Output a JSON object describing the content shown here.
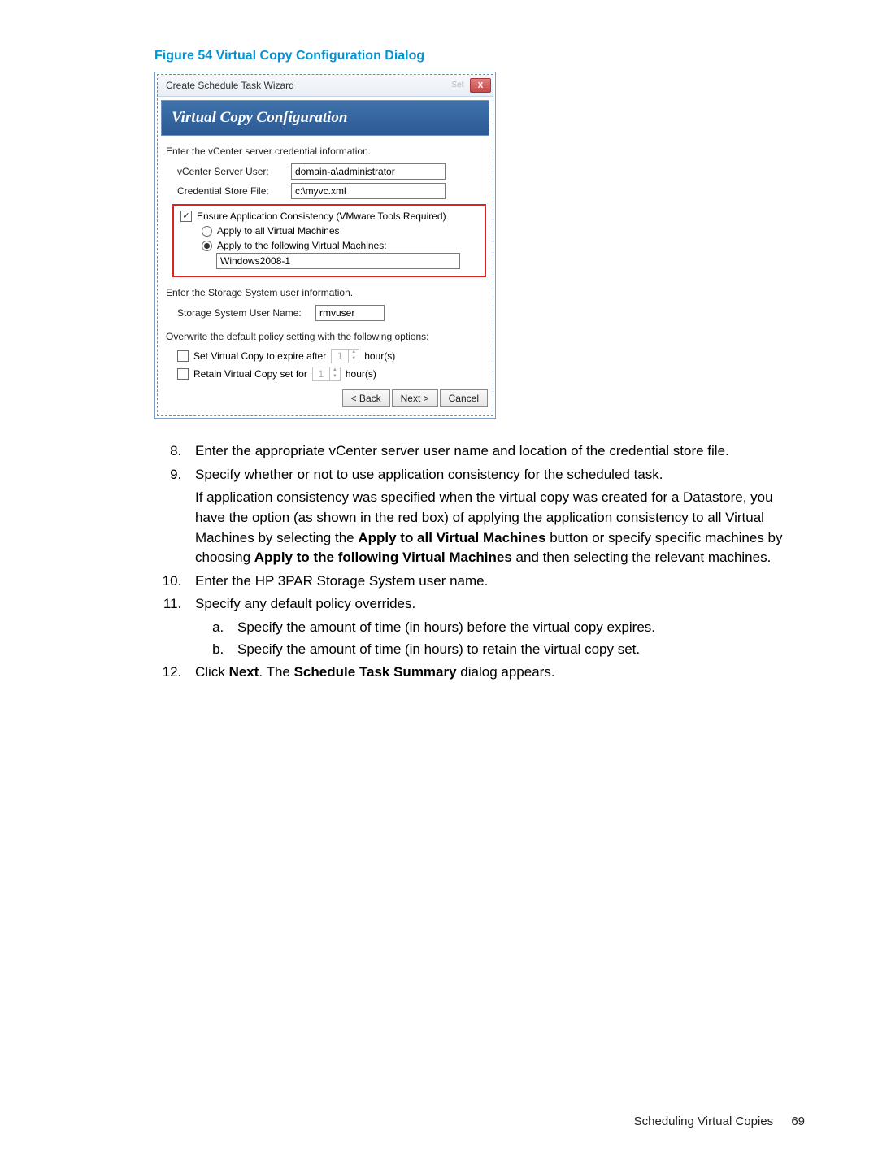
{
  "figure_caption": "Figure 54 Virtual Copy Configuration Dialog",
  "dialog": {
    "window_title": "Create Schedule Task Wizard",
    "set_btn": "Set",
    "close_x": "X",
    "banner": "Virtual Copy Configuration",
    "cred_prompt": "Enter the vCenter server credential information.",
    "user_label": "vCenter Server User:",
    "user_value": "domain-a\\administrator",
    "store_label": "Credential Store File:",
    "store_value": "c:\\myvc.xml",
    "ensure_label": "Ensure Application Consistency (VMware Tools Required)",
    "apply_all_label": "Apply to all Virtual Machines",
    "apply_following_label": "Apply to the following Virtual Machines:",
    "vm_value": "Windows2008-1",
    "storage_prompt": "Enter the Storage System user information.",
    "storage_user_label": "Storage System User Name:",
    "storage_user_value": "rmvuser",
    "overwrite_prompt": "Overwrite the default policy setting with the following options:",
    "expire_label": "Set Virtual Copy to expire after",
    "retain_label": "Retain Virtual Copy set for",
    "spinner_value": "1",
    "hours_label": "hour(s)",
    "back_btn": "< Back",
    "next_btn": "Next >",
    "cancel_btn": "Cancel"
  },
  "steps": {
    "s8": "Enter the appropriate vCenter server user name and location of the credential store file.",
    "s9_a": "Specify whether or not to use application consistency for the scheduled task.",
    "s9_b1": "If application consistency was specified when the virtual copy was created for a Datastore, you have the option (as shown in the red box) of applying the application consistency to all Virtual Machines by selecting the ",
    "s9_b2": "Apply to all Virtual Machines",
    "s9_b3": " button or specify specific machines by choosing ",
    "s9_b4": "Apply to the following Virtual Machines",
    "s9_b5": " and then selecting the relevant machines.",
    "s10": "Enter the HP 3PAR Storage System user name.",
    "s11": "Specify any default policy overrides.",
    "s11a": "Specify the amount of time (in hours) before the virtual copy expires.",
    "s11b": "Specify the amount of time (in hours) to retain the virtual copy set.",
    "s12_a": "Click ",
    "s12_b": "Next",
    "s12_c": ". The ",
    "s12_d": "Schedule Task Summary",
    "s12_e": " dialog appears."
  },
  "footer": {
    "section": "Scheduling Virtual Copies",
    "page": "69"
  }
}
